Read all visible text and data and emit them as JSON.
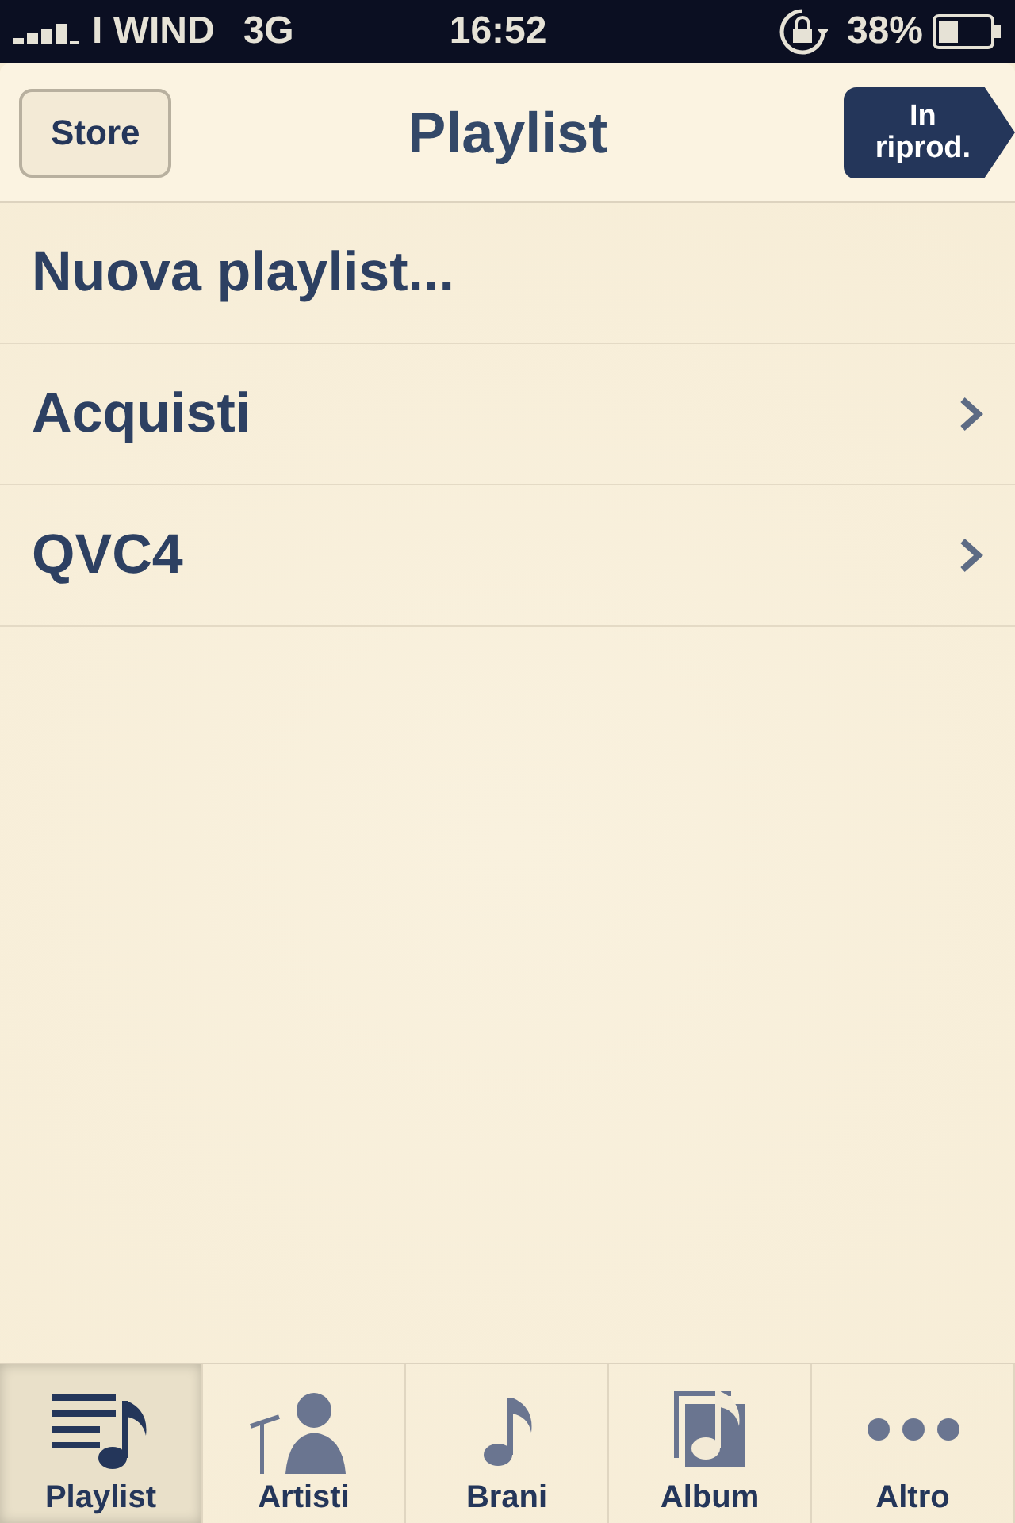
{
  "status_bar": {
    "carrier": "I WIND",
    "network": "3G",
    "time": "16:52",
    "battery": "38%"
  },
  "nav_bar": {
    "left_button": "Store",
    "title": "Playlist",
    "right_button": "In\nriprod."
  },
  "rows": [
    {
      "label": "Nuova playlist...",
      "kind": "action"
    },
    {
      "label": "Acquisti",
      "kind": "folder"
    },
    {
      "label": "QVC4",
      "kind": "folder"
    }
  ],
  "tabs": [
    {
      "label": "Playlist",
      "kind": "playlist",
      "selected": true
    },
    {
      "label": "Artisti",
      "kind": "artist",
      "selected": false
    },
    {
      "label": "Brani",
      "kind": "song",
      "selected": false
    },
    {
      "label": "Album",
      "kind": "album",
      "selected": false
    },
    {
      "label": "Altro",
      "kind": "more",
      "selected": false
    }
  ]
}
